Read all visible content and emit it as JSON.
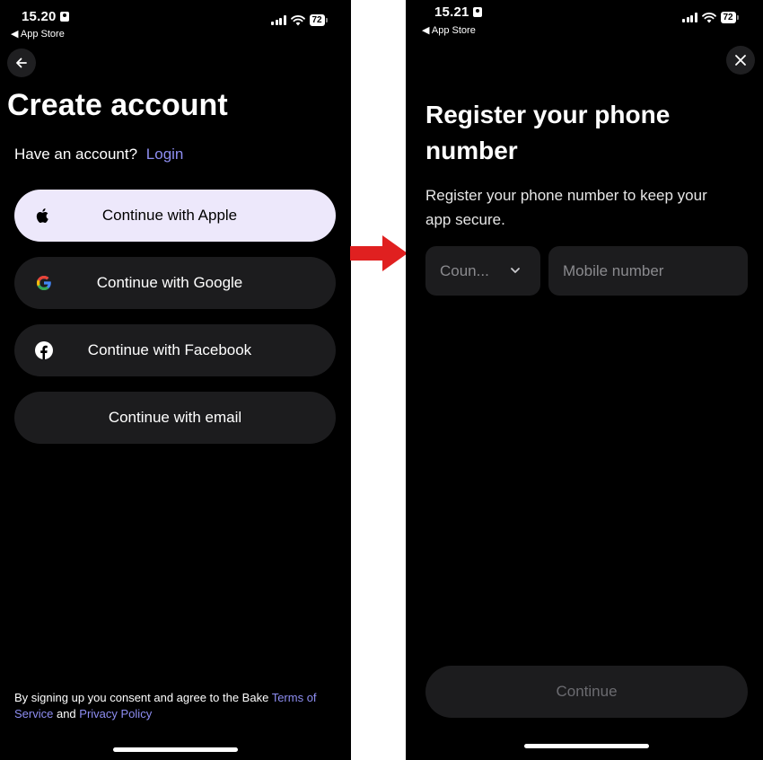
{
  "left_screen": {
    "status_bar": {
      "time": "15.20",
      "back_app": "◀ App Store",
      "battery": "72"
    },
    "title": "Create account",
    "have_account": "Have an account?",
    "login_link": "Login",
    "buttons": [
      {
        "label": "Continue with Apple",
        "icon": "apple-icon"
      },
      {
        "label": "Continue with Google",
        "icon": "google-icon"
      },
      {
        "label": "Continue with Facebook",
        "icon": "facebook-icon"
      },
      {
        "label": "Continue with email",
        "icon": ""
      }
    ],
    "legal": {
      "prefix": "By signing up you consent and agree to the Bake ",
      "terms": "Terms of Service",
      "and": " and ",
      "privacy": "Privacy Policy"
    }
  },
  "right_screen": {
    "status_bar": {
      "time": "15.21",
      "back_app": "◀ App Store",
      "battery": "72"
    },
    "title": "Register your phone number",
    "description": "Register your phone number to keep your app secure.",
    "country_placeholder": "Coun...",
    "mobile_placeholder": "Mobile number",
    "continue_label": "Continue"
  },
  "colors": {
    "background": "#000000",
    "accent_link": "#8e8ef2",
    "apple_button": "#ede8fb",
    "button_dark": "#1c1c1e",
    "arrow": "#e02020"
  }
}
